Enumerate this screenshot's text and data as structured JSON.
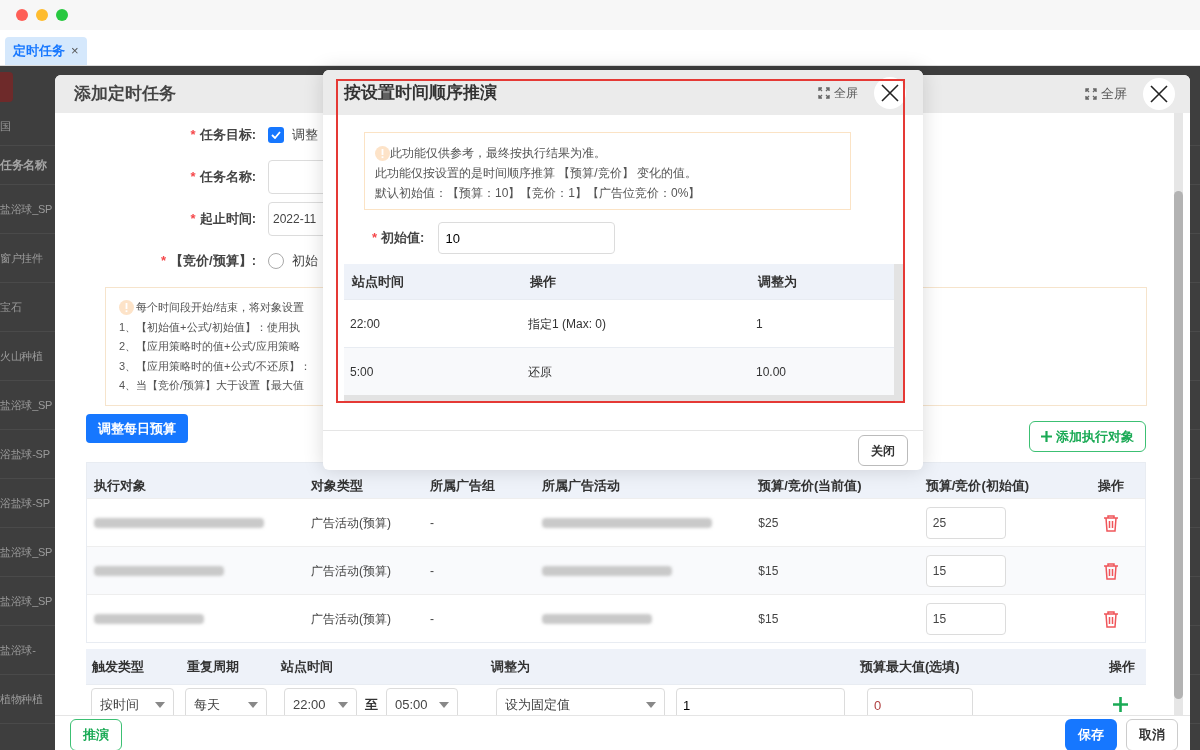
{
  "tab": {
    "label": "定时任务",
    "close": "×"
  },
  "background_list": {
    "filter": "国",
    "header": "任务名称",
    "items": [
      "盐浴球_SP",
      "窗户挂件",
      "宝石",
      "火山种植",
      "盐浴球_SP",
      "浴盐球-SP",
      "浴盐球-SP",
      "盐浴球_SP",
      "盐浴球_SP",
      "盐浴球-",
      "植物种植"
    ]
  },
  "dialog": {
    "title": "添加定时任务",
    "fullscreen": "全屏",
    "form": [
      {
        "kind": "checkbox",
        "mark": "*",
        "label": "任务目标:",
        "text": "调整",
        "checked": true
      },
      {
        "kind": "input",
        "mark": "*",
        "label": "任务名称:"
      },
      {
        "kind": "input",
        "mark": "*",
        "label": "起止时间:",
        "value": "2022-11"
      },
      {
        "kind": "radio",
        "mark": "*",
        "label": "【竞价/预算】:",
        "text": "初始",
        "selected": false
      }
    ],
    "notice": [
      "每个时间段开始/结束，将对象设置",
      "1、【初始值+公式/初始值】：使用执",
      "2、【应用策略时的值+公式/应用策略",
      "3、【应用策略时的值+公式/不还原】：",
      "4、当【竞价/预算】大于设置【最大值"
    ],
    "primary_action": "调整每日预算",
    "add_target": "添加执行对象",
    "targets": {
      "columns": [
        "执行对象",
        "对象类型",
        "所属广告组",
        "所属广告活动",
        "预算/竞价(当前值)",
        "预算/竞价(初始值)",
        "操作"
      ],
      "rows": [
        {
          "type": "广告活动(预算)",
          "group": "-",
          "current": "$25",
          "initial": "25"
        },
        {
          "type": "广告活动(预算)",
          "group": "-",
          "current": "$15",
          "initial": "15"
        },
        {
          "type": "广告活动(预算)",
          "group": "-",
          "current": "$15",
          "initial": "15"
        }
      ]
    },
    "schedule": {
      "columns": [
        "触发类型",
        "重复周期",
        "站点时间",
        "调整为",
        "预算最大值(选填)",
        "操作"
      ],
      "row": {
        "trigger": "按时间",
        "repeat": "每天",
        "from": "22:00",
        "to_word": "至",
        "to": "05:00",
        "adjust": "设为固定值",
        "value": "1",
        "max": "0"
      }
    },
    "footer": {
      "simulate": "推演",
      "save": "保存",
      "cancel": "取消"
    }
  },
  "preview": {
    "title": "按设置时间顺序推演",
    "fullscreen": "全屏",
    "notice": [
      "此功能仅供参考，最终按执行结果为准。",
      "此功能仅按设置的是时间顺序推算 【预算/竞价】 变化的值。",
      "默认初始值：【预算：10】【竞价：1】【广告位竞价：0%】"
    ],
    "initial": {
      "mark": "*",
      "label": "初始值:",
      "value": "10"
    },
    "columns": [
      "站点时间",
      "操作",
      "调整为"
    ],
    "rows": [
      {
        "time": "22:00",
        "action": "指定1 (Max: 0)",
        "result": "1"
      },
      {
        "time": "5:00",
        "action": "还原",
        "result": "10.00"
      }
    ],
    "close": "关闭"
  }
}
